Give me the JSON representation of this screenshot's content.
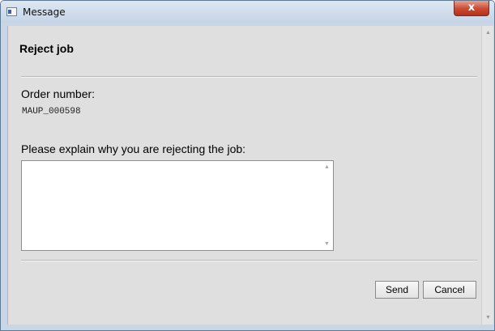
{
  "window": {
    "title": "Message",
    "close_label": "x"
  },
  "dialog": {
    "header": "Reject job",
    "order_label": "Order number:",
    "order_value": "MAUP_000598",
    "reason_label": "Please explain why you are rejecting the job:",
    "reason_value": "",
    "send_label": "Send",
    "cancel_label": "Cancel"
  },
  "icons": {
    "app": "window-app-icon",
    "close": "close-icon",
    "scroll_up": "scroll-up-arrow-icon",
    "scroll_down": "scroll-down-arrow-icon"
  },
  "colors": {
    "titlebar": "#c5d4e6",
    "close_button": "#c94a33",
    "dialog_background": "#dfdfdf"
  }
}
